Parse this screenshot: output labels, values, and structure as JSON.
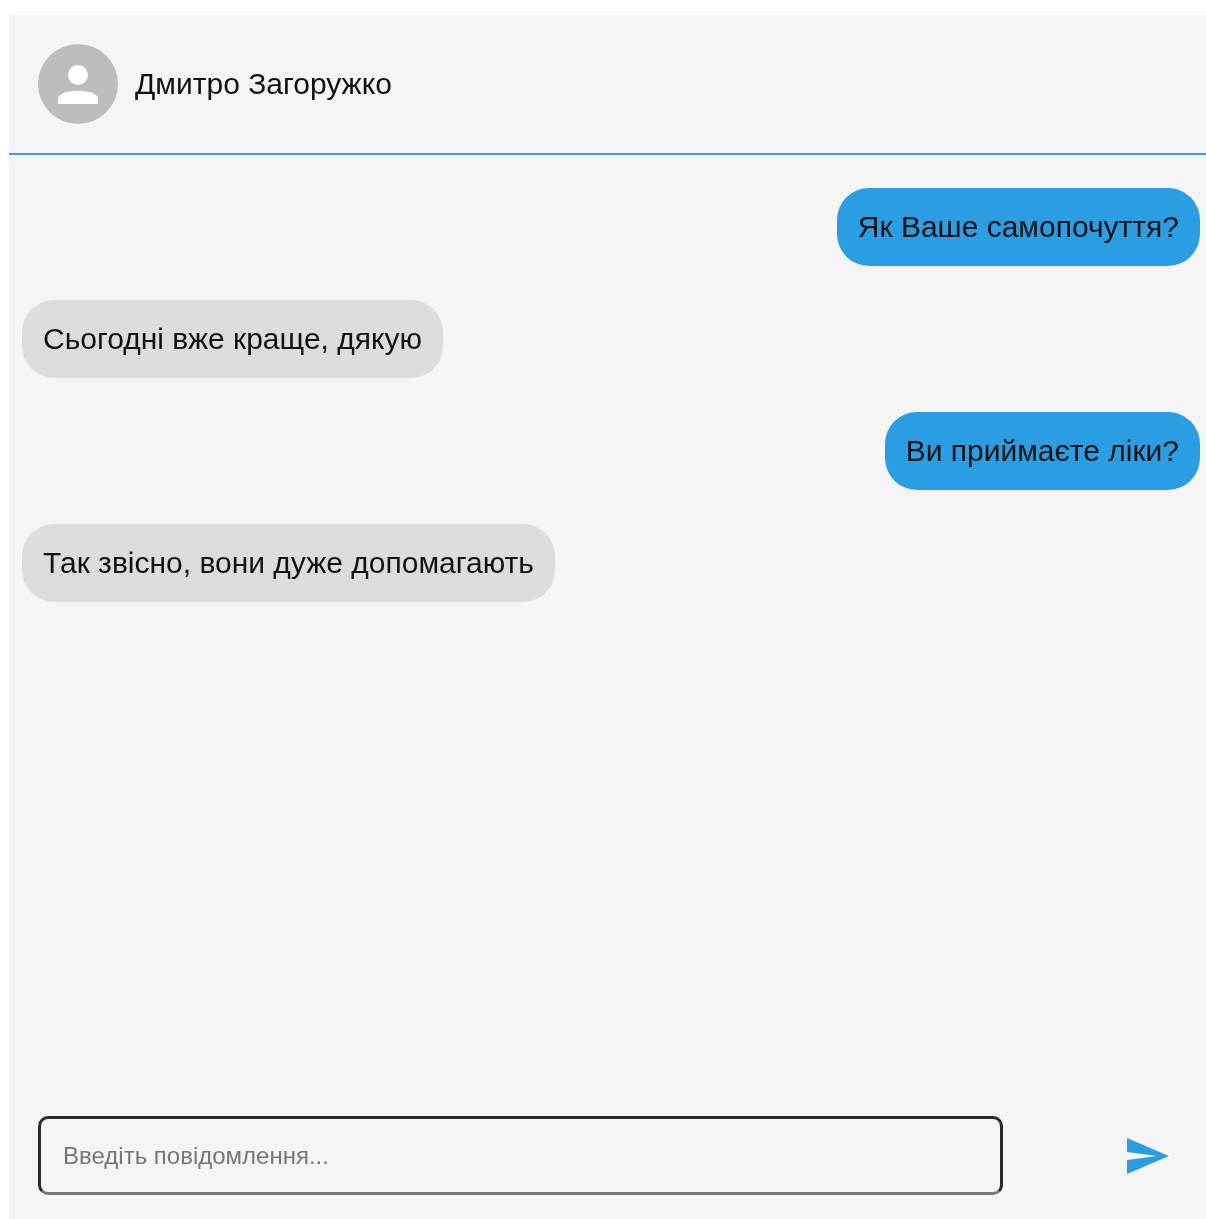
{
  "header": {
    "contact_name": "Дмитро Загоружко"
  },
  "messages": [
    {
      "kind": "outgoing",
      "text": "Як Ваше самопочуття?"
    },
    {
      "kind": "incoming",
      "text": "Сьогодні вже краще, дякую"
    },
    {
      "kind": "outgoing",
      "text": "Ви приймаєте ліки?"
    },
    {
      "kind": "incoming",
      "text": "Так звісно, вони дуже допомагають"
    }
  ],
  "composer": {
    "placeholder": "Введіть повідомлення..."
  }
}
